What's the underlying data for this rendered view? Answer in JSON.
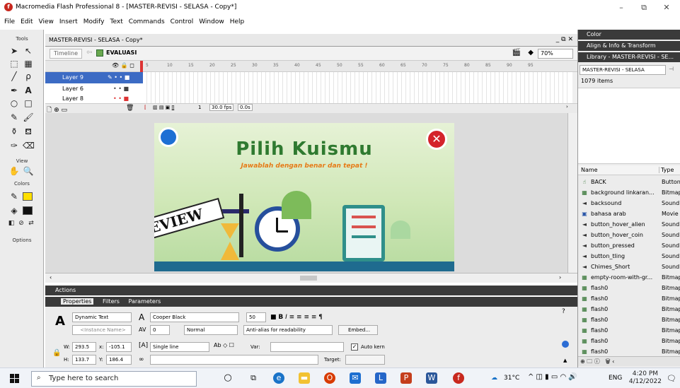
{
  "window": {
    "title": "Macromedia Flash Professional 8 - [MASTER-REVISI - SELASA - Copy*]",
    "min": "–",
    "restore": "⧉",
    "close": "✕"
  },
  "menu": [
    "File",
    "Edit",
    "View",
    "Insert",
    "Modify",
    "Text",
    "Commands",
    "Control",
    "Window",
    "Help"
  ],
  "tools": {
    "label": "Tools",
    "view": "View",
    "colors": "Colors",
    "options": "Options"
  },
  "document": {
    "tab": "MASTER-REVISI - SELASA - Copy*",
    "timeline_button": "Timeline",
    "scene": "EVALUASI",
    "zoom": "70%"
  },
  "timeline": {
    "frame_numbers": [
      "5",
      "10",
      "15",
      "20",
      "25",
      "30",
      "35",
      "40",
      "45",
      "50",
      "55",
      "60",
      "65",
      "70",
      "75",
      "80",
      "85",
      "90",
      "95"
    ],
    "layers": [
      "Layer 9",
      "Layer 6",
      "Layer 8"
    ],
    "frame": "1",
    "fps": "30.0 fps",
    "time": "0.0s"
  },
  "stage": {
    "title": "Pilih Kuismu",
    "subtitle": "Jawablah dengan benar dan tepat !",
    "review": "REVIEW"
  },
  "panels": {
    "actions": "Actions",
    "tabs": [
      "Properties",
      "Filters",
      "Parameters"
    ]
  },
  "properties": {
    "text_type": "Dynamic Text",
    "instance_placeholder": "<Instance Name>",
    "font": "Cooper Black",
    "size": "50",
    "spacing": "0",
    "position": "Normal",
    "antialias": "Anti-alias for readability",
    "embed": "Embed...",
    "w_label": "W:",
    "w": "293.5",
    "x_label": "x:",
    "x": "-105.1",
    "h_label": "H:",
    "h": "133.7",
    "y_label": "Y:",
    "y": "186.4",
    "line": "Single line",
    "var": "Var:",
    "autokern": "Auto kern",
    "target": "Target:"
  },
  "right_panels": {
    "color": "Color",
    "align": "Align & Info & Transform",
    "library": "Library - MASTER-REVISI - SE...",
    "library_select": "MASTER-REVISI - SELASA",
    "count": "1079 items",
    "col_name": "Name",
    "col_type": "Type"
  },
  "library_items": [
    {
      "name": "BACK",
      "type": "Button",
      "icon": "button-icon"
    },
    {
      "name": "background linkaran...",
      "type": "Bitmap",
      "icon": "bitmap-icon"
    },
    {
      "name": "backsound",
      "type": "Sound",
      "icon": "sound-icon"
    },
    {
      "name": "bahasa arab",
      "type": "Movie",
      "icon": "movie-icon"
    },
    {
      "name": "button_hover_alien",
      "type": "Sound",
      "icon": "sound-icon"
    },
    {
      "name": "button_hover_coin",
      "type": "Sound",
      "icon": "sound-icon"
    },
    {
      "name": "button_pressed",
      "type": "Sound",
      "icon": "sound-icon"
    },
    {
      "name": "button_tling",
      "type": "Sound",
      "icon": "sound-icon"
    },
    {
      "name": "Chimes_Short",
      "type": "Sound",
      "icon": "sound-icon"
    },
    {
      "name": "empty-room-with-gr...",
      "type": "Bitmap",
      "icon": "bitmap-icon"
    },
    {
      "name": "flash0",
      "type": "Bitmap",
      "icon": "bitmap-icon"
    },
    {
      "name": "flash0",
      "type": "Bitmap",
      "icon": "bitmap-icon"
    },
    {
      "name": "flash0",
      "type": "Bitmap",
      "icon": "bitmap-icon"
    },
    {
      "name": "flash0",
      "type": "Bitmap",
      "icon": "bitmap-icon"
    },
    {
      "name": "flash0",
      "type": "Bitmap",
      "icon": "bitmap-icon"
    },
    {
      "name": "flash0",
      "type": "Bitmap",
      "icon": "bitmap-icon"
    },
    {
      "name": "flash0",
      "type": "Bitmap",
      "icon": "bitmap-icon"
    },
    {
      "name": "flash0",
      "type": "Bitmap",
      "icon": "bitmap-icon"
    },
    {
      "name": "flash0",
      "type": "Bitmap",
      "icon": "bitmap-icon"
    }
  ],
  "taskbar": {
    "search_placeholder": "Type here to search",
    "weather": "31°C",
    "lang": "ENG",
    "time": "4:20 PM",
    "date": "4/12/2022"
  }
}
